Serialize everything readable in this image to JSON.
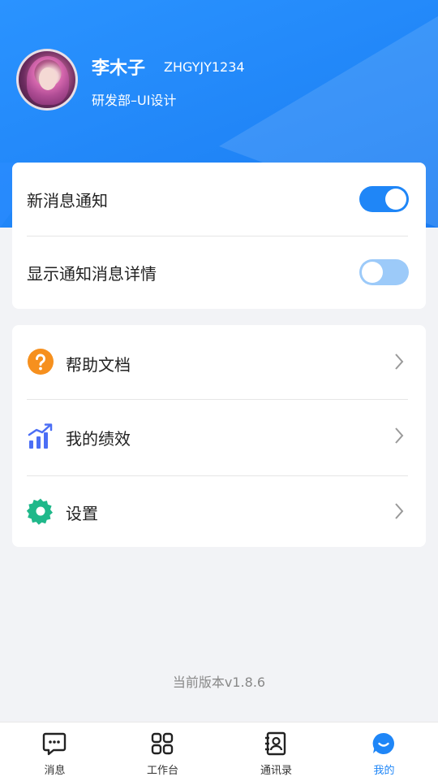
{
  "colors": {
    "primary": "#1f86f7",
    "toggle_on": "#1f86f7",
    "toggle_off": "#9ccaf9",
    "help_orange": "#f6901e",
    "settings_green": "#1fb88a",
    "chart_blue": "#4b6ef5"
  },
  "profile": {
    "name": "李木子",
    "id": "ZHGYJY1234",
    "department": "研发部–UI设计"
  },
  "notifications": [
    {
      "label": "新消息通知",
      "enabled": true
    },
    {
      "label": "显示通知消息详情",
      "enabled": false
    }
  ],
  "menu": [
    {
      "label": "帮助文档",
      "icon": "help-icon"
    },
    {
      "label": "我的绩效",
      "icon": "performance-chart-icon"
    },
    {
      "label": "设置",
      "icon": "settings-gear-icon"
    }
  ],
  "version": "当前版本v1.8.6",
  "tabs": [
    {
      "label": "消息",
      "icon": "message-icon",
      "active": false
    },
    {
      "label": "工作台",
      "icon": "workbench-icon",
      "active": false
    },
    {
      "label": "通讯录",
      "icon": "contacts-icon",
      "active": false
    },
    {
      "label": "我的",
      "icon": "profile-icon",
      "active": true
    }
  ]
}
